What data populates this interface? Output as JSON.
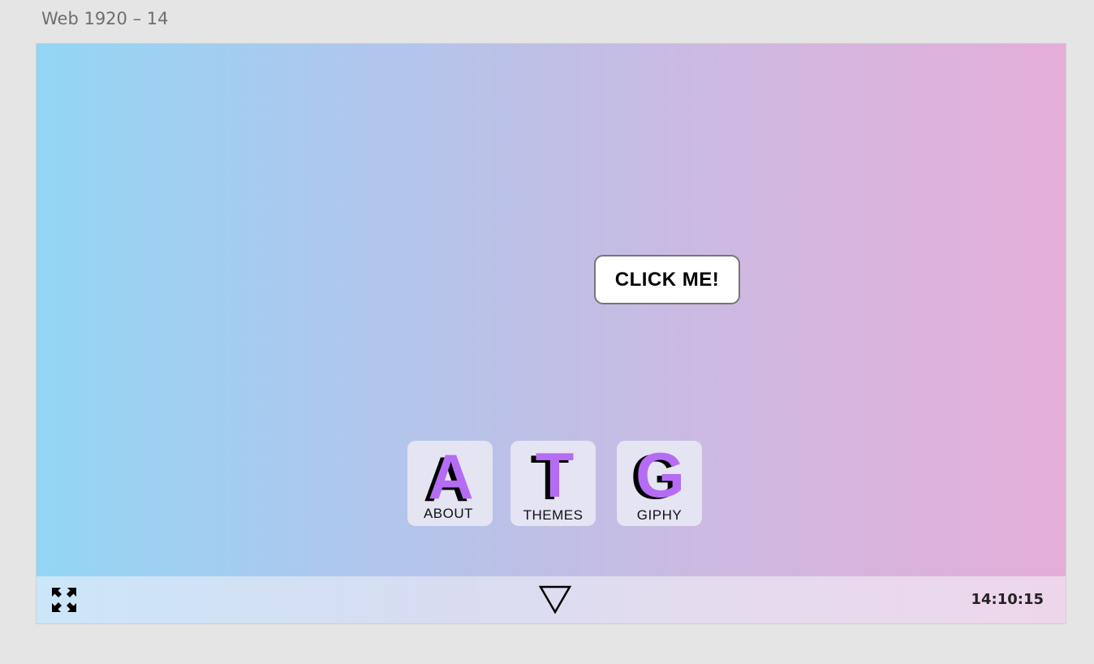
{
  "artboard": {
    "label": "Web 1920 – 14"
  },
  "main": {
    "click_button_label": "CLICK ME!"
  },
  "apps": [
    {
      "letter": "A",
      "label": "ABOUT"
    },
    {
      "letter": "T",
      "label": "THEMES"
    },
    {
      "letter": "G",
      "label": "GIPHY"
    }
  ],
  "taskbar": {
    "left_icon": "fullscreen-icon",
    "center_icon": "triangle-down-icon",
    "clock": "14:10:15"
  },
  "colors": {
    "accent": "#b56cf4",
    "gradient_start": "#93d6f4",
    "gradient_end": "#e4aed7"
  }
}
